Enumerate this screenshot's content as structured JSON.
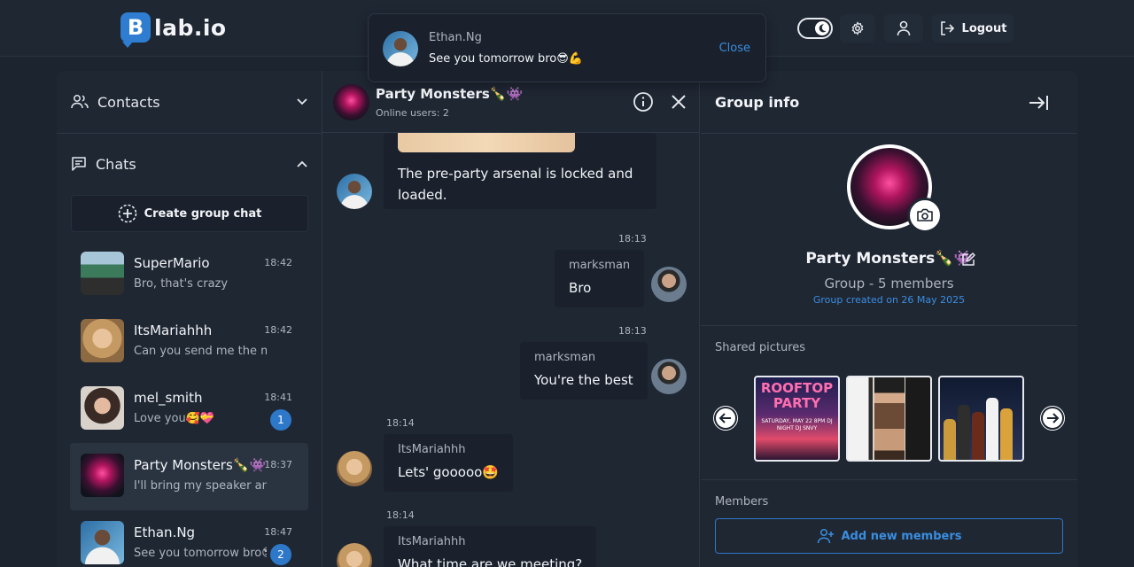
{
  "header": {
    "logo_letter": "B",
    "logo_text": "lab.io",
    "logout_label": "Logout"
  },
  "toast": {
    "sender": "Ethan.Ng",
    "message": "See you tomorrow bro😎💪",
    "close_label": "Close"
  },
  "sidebar": {
    "contacts_label": "Contacts",
    "chats_label": "Chats",
    "create_group_label": "Create group chat",
    "chats": [
      {
        "name": "SuperMario",
        "time": "18:42",
        "preview": "Bro, that's crazy",
        "badge": ""
      },
      {
        "name": "ItsMariahhh",
        "time": "18:42",
        "preview": "Can you send me the mc",
        "badge": ""
      },
      {
        "name": "mel_smith",
        "time": "18:41",
        "preview": "Love you🥰💝",
        "badge": "1"
      },
      {
        "name": "Party Monsters🍾👾",
        "time": "18:37",
        "preview": "I'll bring my speaker and",
        "badge": ""
      },
      {
        "name": "Ethan.Ng",
        "time": "18:47",
        "preview": "See you tomorrow bro😎",
        "badge": "2"
      }
    ]
  },
  "chat": {
    "title": "Party Monsters🍾👾",
    "online": "Online users: 2",
    "messages": [
      {
        "sender": "",
        "text": "The pre-party arsenal is locked and loaded.",
        "time": ""
      },
      {
        "sender": "marksman",
        "text": "Bro",
        "time": "18:13"
      },
      {
        "sender": "marksman",
        "text": "You're the best",
        "time": "18:13"
      },
      {
        "sender": "ItsMariahhh",
        "text": "Lets' gooooo🤩",
        "time": "18:14"
      },
      {
        "sender": "ItsMariahhh",
        "text": "What time are we meeting?",
        "time": "18:14"
      }
    ]
  },
  "info": {
    "title": "Group info",
    "group_name": "Party Monsters🍾👾",
    "members_count": "Group - 5 members",
    "created": "Group created on 26 May 2025",
    "shared_label": "Shared pictures",
    "poster_line1": "ROOFTOP",
    "poster_line2": "PARTY",
    "poster_details": "SATURDAY, MAY 22 8PM DJ NIGHT DJ SNVY",
    "members_label": "Members",
    "add_members_label": "Add new members"
  },
  "colors": {
    "accent": "#2d78c8",
    "background": "#1c2430",
    "panel": "#1f2733"
  }
}
